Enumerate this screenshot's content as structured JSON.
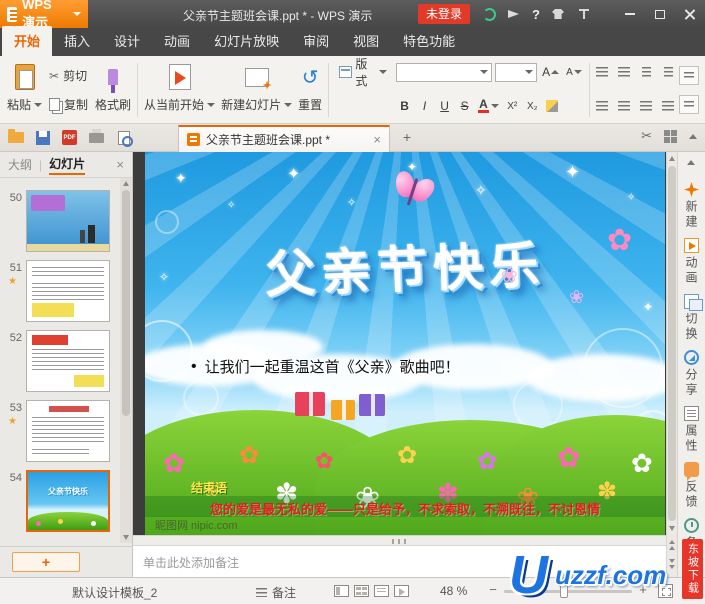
{
  "titlebar": {
    "app_button": "WPS 演示",
    "doc_title": "父亲节主题班会课.ppt * - WPS 演示",
    "login_button": "未登录",
    "help_icon": "?"
  },
  "ribbon_tabs": {
    "items": [
      {
        "label": "开始"
      },
      {
        "label": "插入"
      },
      {
        "label": "设计"
      },
      {
        "label": "动画"
      },
      {
        "label": "幻灯片放映"
      },
      {
        "label": "审阅"
      },
      {
        "label": "视图"
      },
      {
        "label": "特色功能"
      }
    ]
  },
  "ribbon": {
    "paste": "粘贴",
    "cut": "剪切",
    "copy": "复制",
    "format_painter": "格式刷",
    "from_current": "从当前开始",
    "new_slide": "新建幻灯片",
    "reset": "重置",
    "layout": "版式",
    "font_name": "",
    "font_size": "",
    "bold": "B",
    "italic": "I",
    "underline": "U",
    "strike": "S",
    "font_color": "A",
    "grow_font": "A",
    "shrink_font": "A",
    "superscript": "X²",
    "subscript": "X₂"
  },
  "icons": {
    "cut": "✂",
    "reset": "↺"
  },
  "doc_row": {
    "tab_label": "父亲节主题班会课.ppt *",
    "new_tab": "+",
    "close": "×",
    "pdf_label": "PDF"
  },
  "left_panel": {
    "outline_tab": "大纲",
    "slides_tab": "幻灯片",
    "divider": "|",
    "close": "×",
    "star": "★",
    "add_button": "+",
    "slides": [
      {
        "num": "50"
      },
      {
        "num": "51"
      },
      {
        "num": "52"
      },
      {
        "num": "53"
      },
      {
        "num": "54"
      }
    ]
  },
  "slide": {
    "title": "父亲节快乐",
    "bullet_marker": "•",
    "bullet": "让我们一起重温这首《父亲》歌曲吧！",
    "ending_label": "结束语",
    "ending_line": "您的爱是最无私的爱——只是给予，不求索取，不溯既往，不讨恩情",
    "watermark": "昵图网 nipic.com",
    "mini_title": "父亲节快乐",
    "decor": {
      "sparkle": "✦",
      "sparkle_small": "✧",
      "flower": "✿",
      "flower_alt": "❀",
      "flower_white": "✽"
    }
  },
  "notes": {
    "placeholder": "单击此处添加备注"
  },
  "sidebar": {
    "items": [
      {
        "label": "新建"
      },
      {
        "label": "动画"
      },
      {
        "label": "切换"
      },
      {
        "label": "分享"
      },
      {
        "label": "属性"
      },
      {
        "label": "反馈"
      },
      {
        "label": "备份"
      }
    ]
  },
  "statusbar": {
    "template_name": "默认设计模板_2",
    "notes_label": "备注",
    "zoom_level": "48 %",
    "zoom_out": "−",
    "zoom_in": "+"
  },
  "brand_watermark": {
    "letter": "U",
    "site": "uzzf.com",
    "banner": "东坡下载"
  }
}
